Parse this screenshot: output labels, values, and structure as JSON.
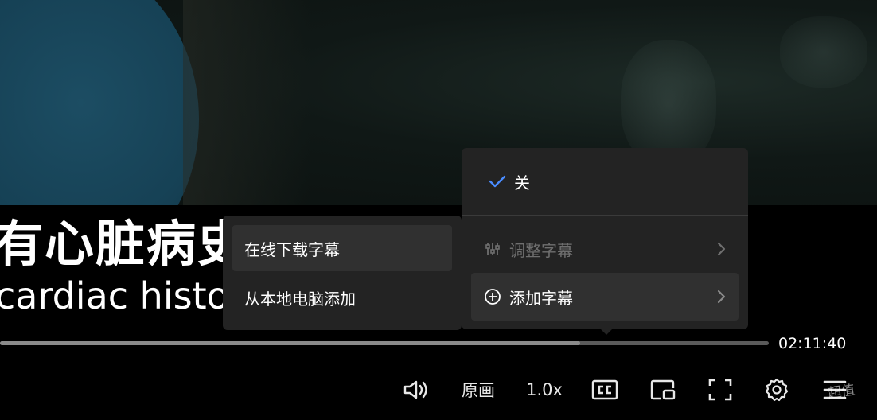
{
  "subtitles": {
    "chinese": "有心脏病史",
    "english": "cardiac history"
  },
  "player": {
    "time_remaining": "02:11:40",
    "progress": 0.755,
    "quality_label": "原画",
    "speed_label": "1.0x"
  },
  "subtitle_menu": {
    "off_label": "关",
    "off_selected": true,
    "adjust_label": "调整字幕",
    "add_label": "添加字幕"
  },
  "add_submenu": {
    "online_label": "在线下载字幕",
    "local_label": "从本地电脑添加"
  },
  "watermark": "超值",
  "colors": {
    "accent_check": "#4a8cff",
    "menu_bg": "#232323",
    "menu_hover": "#303030"
  },
  "icons": [
    "volume-icon",
    "cc-icon",
    "pip-icon",
    "fullscreen-icon",
    "gear-icon",
    "playlist-icon",
    "check-icon",
    "sliders-icon",
    "plus-circle-icon",
    "chevron-right-icon"
  ]
}
